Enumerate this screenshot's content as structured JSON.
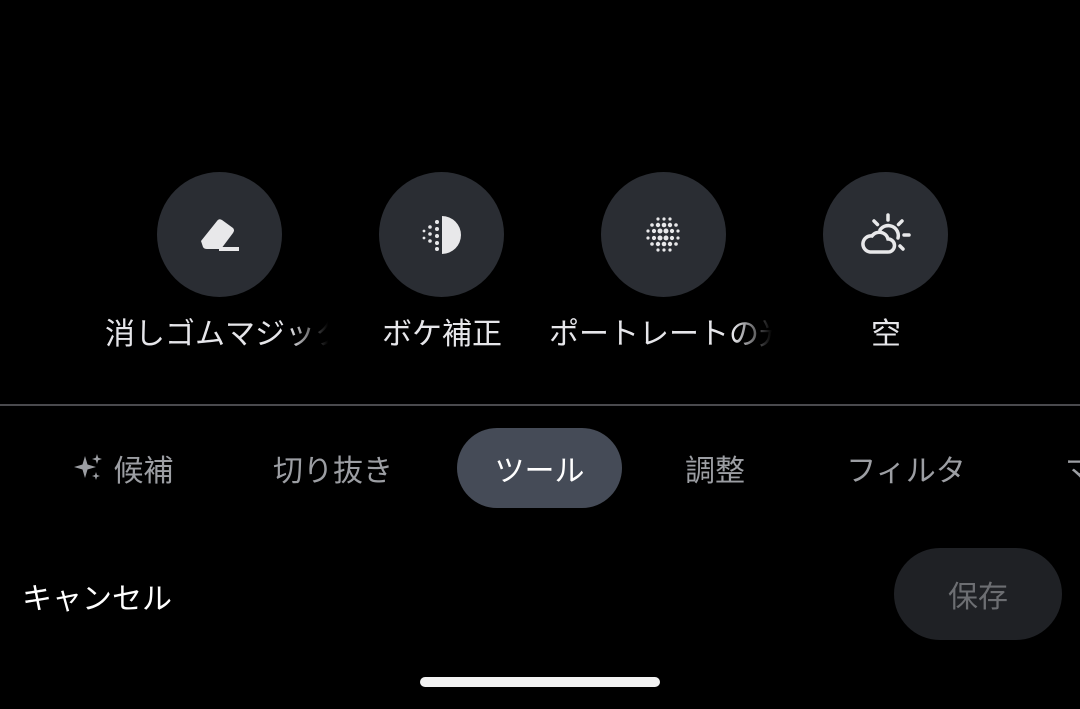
{
  "tools": [
    {
      "label": "消しゴムマジック",
      "icon": "eraser-icon"
    },
    {
      "label": "ボケ補正",
      "icon": "half-dots-icon"
    },
    {
      "label": "ポートレートの光",
      "icon": "dot-grid-icon"
    },
    {
      "label": "空",
      "icon": "sun-cloud-icon"
    }
  ],
  "tabs": [
    {
      "label": "候補",
      "icon": "sparkle-icon",
      "active": false
    },
    {
      "label": "切り抜き",
      "active": false
    },
    {
      "label": "ツール",
      "active": true
    },
    {
      "label": "調整",
      "active": false
    },
    {
      "label": "フィルタ",
      "active": false
    },
    {
      "label": "マークアップ",
      "active": false
    }
  ],
  "bottom": {
    "cancel_label": "キャンセル",
    "save_label": "保存"
  },
  "colors": {
    "background": "#000000",
    "tool_circle": "#2a2d33",
    "active_tab": "#454b57",
    "save_button": "#1f2125"
  }
}
